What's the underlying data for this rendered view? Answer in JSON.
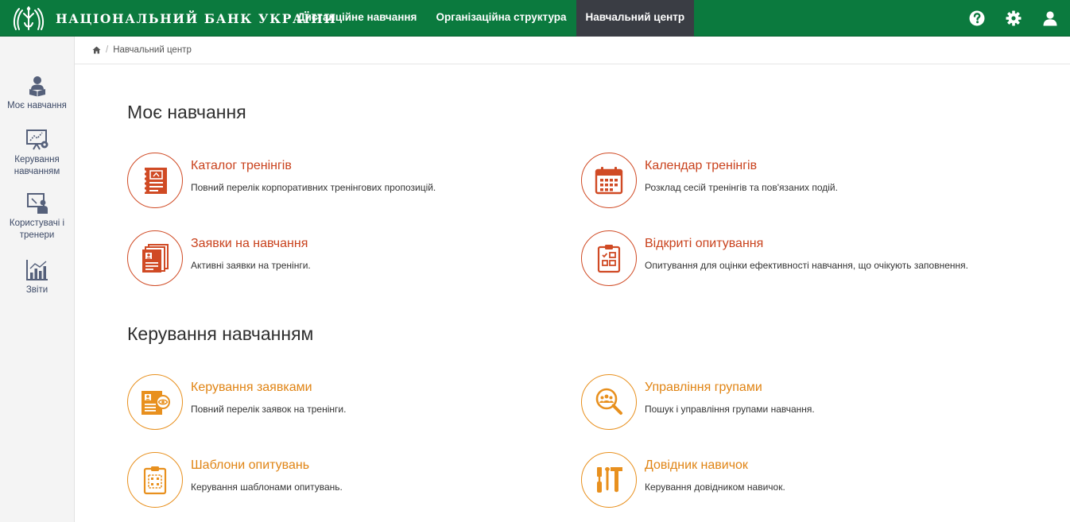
{
  "header": {
    "brand": "НАЦІОНАЛЬНИЙ БАНК УКРАЇНИ",
    "nav": [
      {
        "label": "Дистанційне навчання"
      },
      {
        "label": "Організаційна структура"
      },
      {
        "label": "Навчальний центр"
      }
    ],
    "active_nav": "Навчальний центр"
  },
  "sidebar": {
    "items": [
      {
        "label": "Моє навчання",
        "icon": "reader-icon"
      },
      {
        "label": "Керування навчанням",
        "icon": "presentation-gear-icon"
      },
      {
        "label": "Користувачі і тренери",
        "icon": "trainer-board-icon"
      },
      {
        "label": "Звіти",
        "icon": "bar-chart-icon"
      }
    ]
  },
  "breadcrumb": {
    "current": "Навчальний центр"
  },
  "sections": [
    {
      "title": "Моє навчання",
      "cards": [
        {
          "title": "Каталог тренінгів",
          "desc": "Повний перелік корпоративних тренінгових пропозицій.",
          "icon": "catalog-notebook-icon"
        },
        {
          "title": "Календар тренінгів",
          "desc": "Розклад сесій тренінгів та пов'язаних подій.",
          "icon": "calendar-icon"
        },
        {
          "title": "Заявки на навчання",
          "desc": "Активні заявки на тренінги.",
          "icon": "applications-stack-icon"
        },
        {
          "title": "Відкриті опитування",
          "desc": "Опитування для оцінки ефективності навчання, що очікують заповнення.",
          "icon": "clipboard-checklist-icon"
        }
      ]
    },
    {
      "title": "Керування навчанням",
      "cards": [
        {
          "title": "Керування заявками",
          "desc": "Повний перелік заявок на тренінги.",
          "icon": "application-review-icon"
        },
        {
          "title": "Управління групами",
          "desc": "Пошук і управління групами навчання.",
          "icon": "group-search-icon"
        },
        {
          "title": "Шаблони опитувань",
          "desc": "Керування шаблонами опитувань.",
          "icon": "survey-template-icon"
        },
        {
          "title": "Довідник навичок",
          "desc": "Керування довідником навичок.",
          "icon": "tools-icon"
        }
      ]
    }
  ],
  "colors": {
    "header_green": "#0b7a3e",
    "active_tab": "#3a3d44",
    "section1_accent": "#d04a24",
    "section2_accent": "#e8901e"
  }
}
